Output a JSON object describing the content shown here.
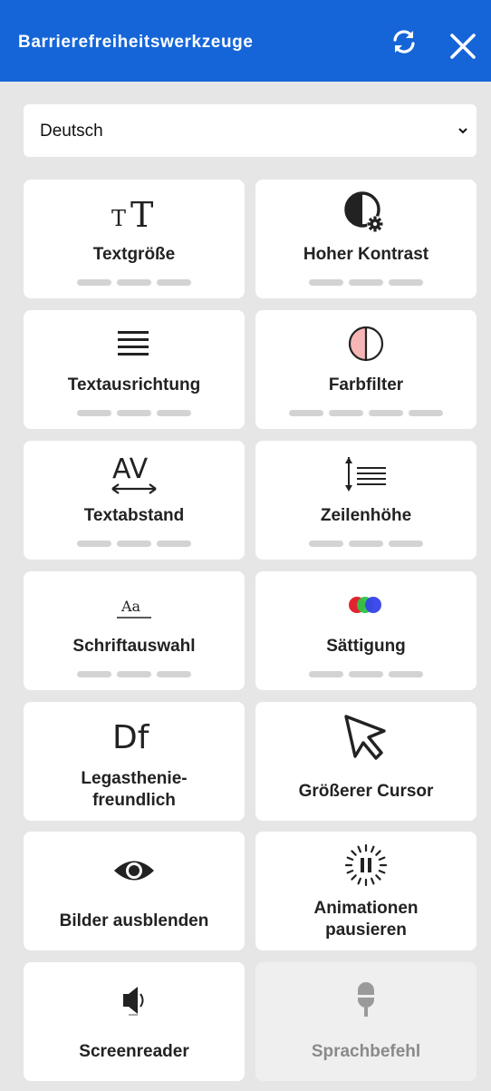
{
  "header": {
    "title": "Barrierefreiheitswerkzeuge",
    "reset_icon": "refresh-icon",
    "close_icon": "close-icon"
  },
  "language": {
    "selected": "Deutsch"
  },
  "tools": [
    {
      "label": "Textgröße",
      "icon": "text-size-icon",
      "levels": 3
    },
    {
      "label": "Hoher Kontrast",
      "icon": "contrast-icon",
      "levels": 3
    },
    {
      "label": "Textausrichtung",
      "icon": "text-align-icon",
      "levels": 3
    },
    {
      "label": "Farbfilter",
      "icon": "color-filter-icon",
      "levels": 4
    },
    {
      "label": "Textabstand",
      "icon": "letter-spacing-icon",
      "levels": 3
    },
    {
      "label": "Zeilenhöhe",
      "icon": "line-height-icon",
      "levels": 3
    },
    {
      "label": "Schriftauswahl",
      "icon": "font-select-icon",
      "icon_text": "Aa",
      "levels": 3
    },
    {
      "label": "Sättigung",
      "icon": "saturation-icon",
      "levels": 3
    },
    {
      "label": "Legasthenie-\nfreundlich",
      "icon": "dyslexia-icon",
      "icon_text": "Df"
    },
    {
      "label": "Größerer Cursor",
      "icon": "cursor-icon"
    },
    {
      "label": "Bilder ausblenden",
      "icon": "eye-icon"
    },
    {
      "label": "Animationen\npausieren",
      "icon": "pause-animation-icon"
    },
    {
      "label": "Screenreader",
      "icon": "speaker-icon"
    },
    {
      "label": "Sprachbefehl",
      "icon": "microphone-icon",
      "disabled": true
    }
  ],
  "colors": {
    "header": "#1565d8",
    "background": "#e6e6e6",
    "card": "#ffffff",
    "card_disabled": "#efefef",
    "level_inactive": "#d3d3d3"
  }
}
